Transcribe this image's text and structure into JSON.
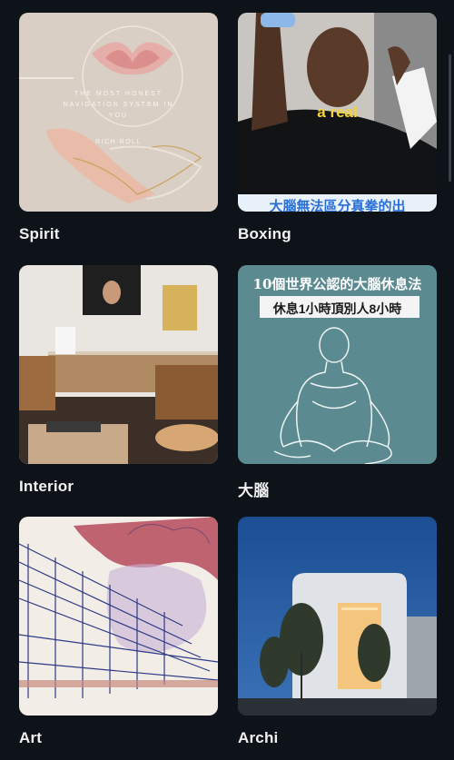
{
  "boards": [
    {
      "label": "Spirit",
      "overlay_lines": [
        "THE MOST HONEST",
        "NAVIGATION SYSTEM IN",
        "YOU"
      ],
      "overlay_author": "RICH ROLL"
    },
    {
      "label": "Boxing",
      "overlay_caption": "a real",
      "overlay_subtitle": "大腦無法區分真拳的出"
    },
    {
      "label": "Interior"
    },
    {
      "label": "大腦",
      "overlay_title": "10個世界公認的大腦休息法",
      "overlay_subtitle": "休息1小時頂別人8小時"
    },
    {
      "label": "Art"
    },
    {
      "label": "Archi"
    }
  ],
  "colors": {
    "background": "#0e1319",
    "label": "#f2f2f2",
    "caption_yellow": "#f5d33a"
  }
}
